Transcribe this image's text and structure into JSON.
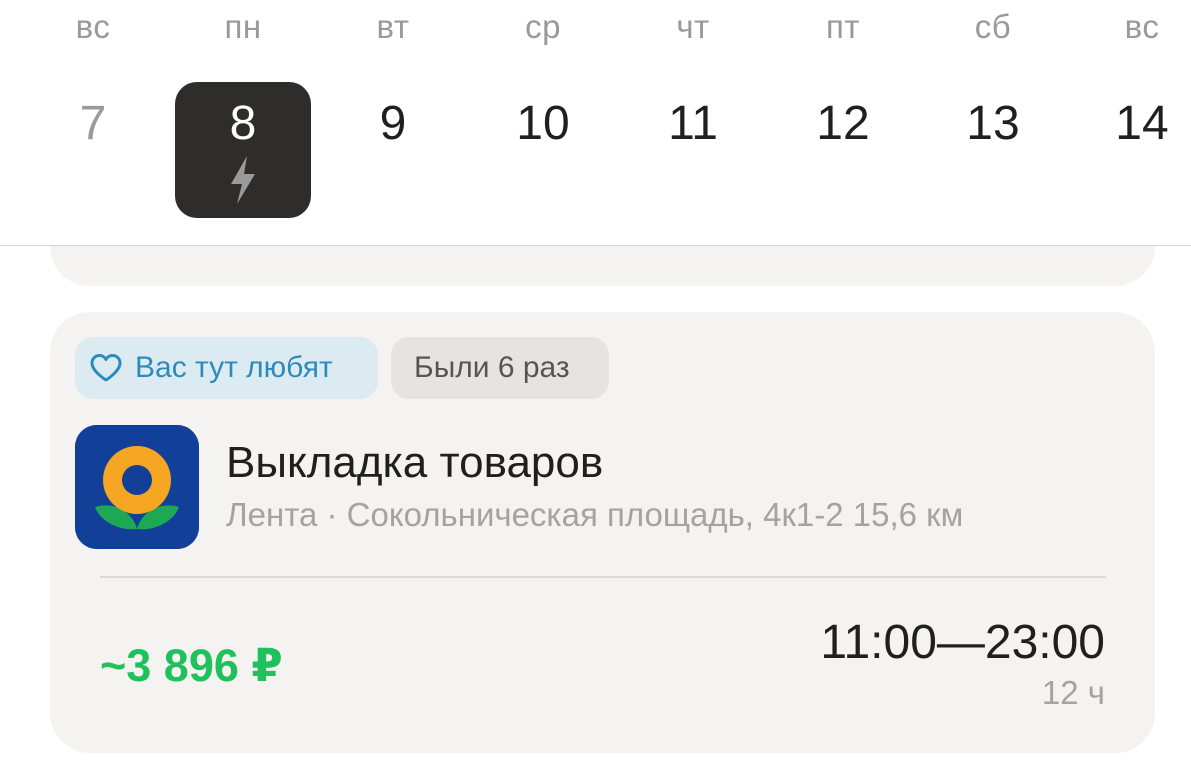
{
  "calendar": {
    "days": [
      {
        "weekday": "вс",
        "date": "7"
      },
      {
        "weekday": "пн",
        "date": "8"
      },
      {
        "weekday": "вт",
        "date": "9"
      },
      {
        "weekday": "ср",
        "date": "10"
      },
      {
        "weekday": "чт",
        "date": "11"
      },
      {
        "weekday": "пт",
        "date": "12"
      },
      {
        "weekday": "сб",
        "date": "13"
      },
      {
        "weekday": "вс",
        "date": "14"
      }
    ],
    "selected_icon": "lightning-bolt-icon"
  },
  "job": {
    "badges": {
      "loved": "Вас тут любят",
      "loved_icon": "heart-outline-icon",
      "visits": "Были 6 раз"
    },
    "logo_icon": "lenta-sunflower-logo",
    "title": "Выкладка товаров",
    "subtitle": "Лента · Сокольническая площадь, 4к1-2 15,6 км",
    "price": "~3 896 ₽",
    "time_range": "11:00—23:00",
    "duration": "12 ч"
  },
  "colors": {
    "selected_day_bg": "#2e2d2c",
    "price": "#20c05c",
    "badge_loved_bg": "#dcebf1",
    "badge_loved_text": "#2c8bbd",
    "card_bg": "#f4f3f1",
    "logo_bg": "#123f97",
    "logo_petals": "#f5a623",
    "logo_leaves": "#1fa854"
  }
}
